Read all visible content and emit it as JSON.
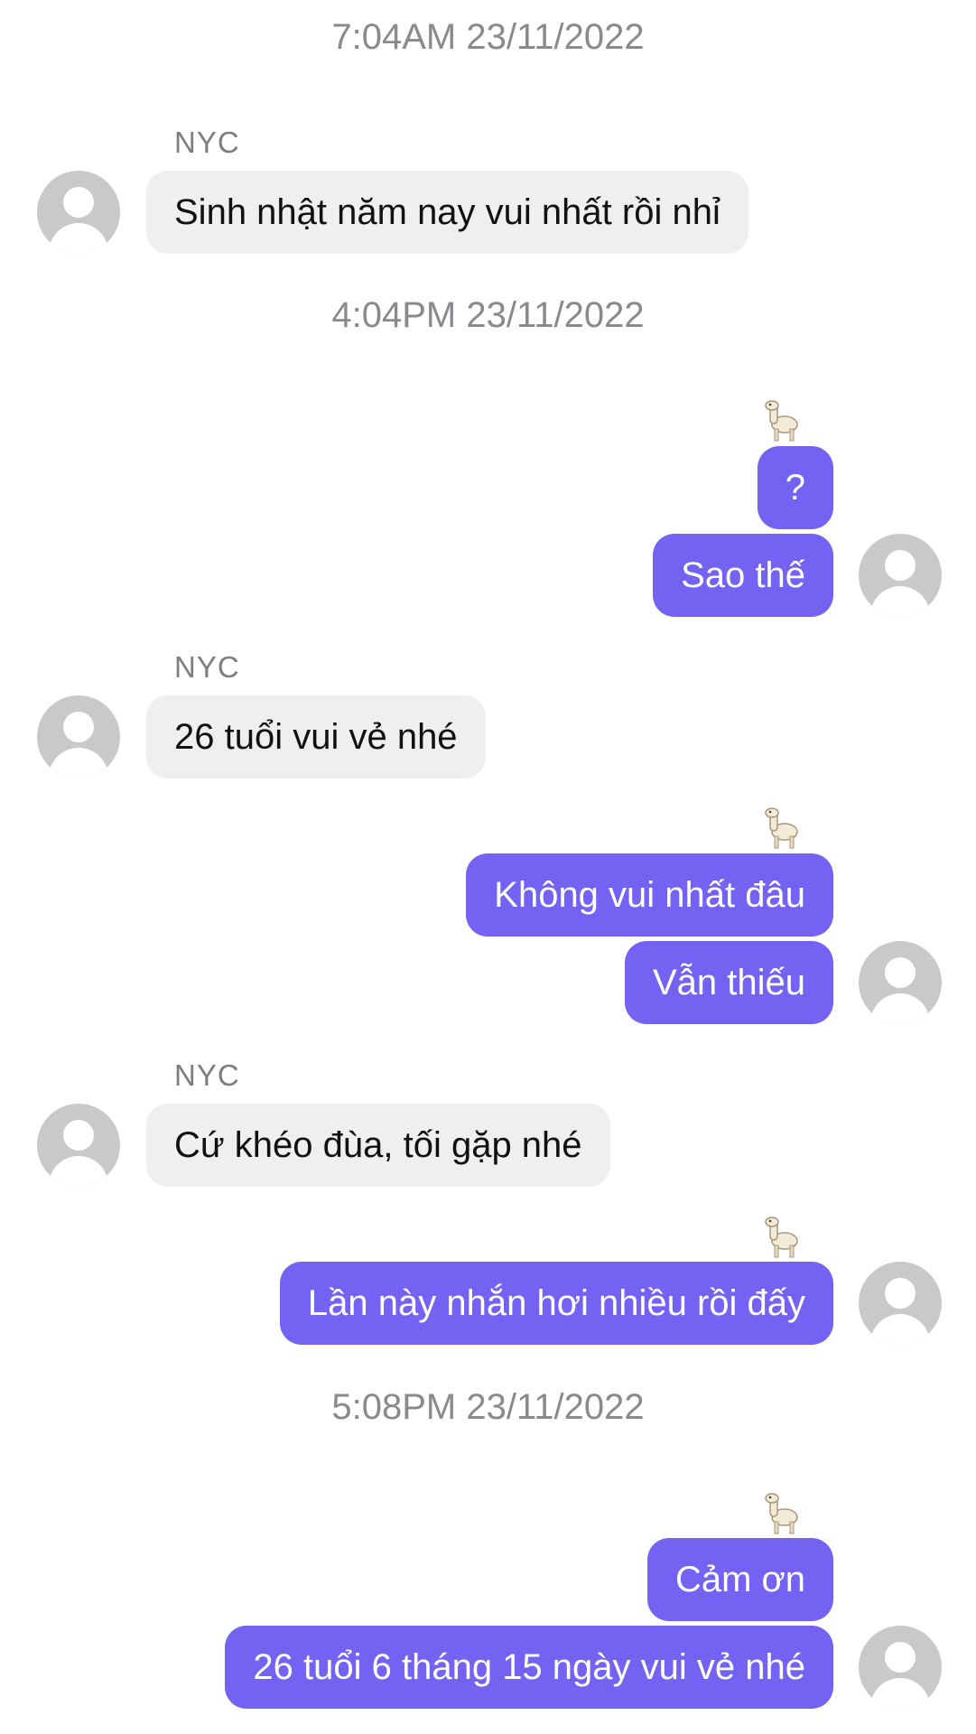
{
  "conversation": {
    "timestamps": [
      "7:04AM 23/11/2022",
      "4:04PM 23/11/2022",
      "5:08PM 23/11/2022"
    ],
    "contact_name": "NYC",
    "messages": [
      {
        "from": "NYC",
        "text": "Sinh nhật năm nay vui nhất rồi nhỉ"
      },
      {
        "from": "me",
        "text": "?"
      },
      {
        "from": "me",
        "text": "Sao thế"
      },
      {
        "from": "NYC",
        "text": "26 tuổi vui vẻ nhé"
      },
      {
        "from": "me",
        "text": "Không vui nhất đâu"
      },
      {
        "from": "me",
        "text": "Vẫn thiếu"
      },
      {
        "from": "NYC",
        "text": "Cứ khéo đùa, tối gặp nhé"
      },
      {
        "from": "me",
        "text": "Lần này nhắn hơi nhiều rồi đấy"
      },
      {
        "from": "me",
        "text": "Cảm ơn"
      },
      {
        "from": "me",
        "text": "26 tuổi 6 tháng 15 ngày vui vẻ nhé"
      }
    ],
    "reaction_icon": "llama-icon"
  },
  "colors": {
    "outgoing_bubble": "#7562f2",
    "incoming_bubble": "#efeff1",
    "timestamp_text": "#8a8a8e",
    "avatar_placeholder": "#c9c9cc"
  }
}
